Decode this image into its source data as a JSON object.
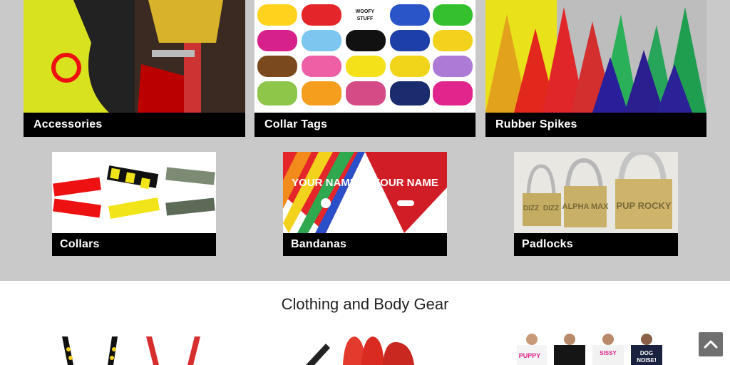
{
  "categories_row1": [
    {
      "label": "Accessories"
    },
    {
      "label": "Collar Tags"
    },
    {
      "label": "Rubber Spikes"
    }
  ],
  "categories_row2": [
    {
      "label": "Collars"
    },
    {
      "label": "Bandanas"
    },
    {
      "label": "Padlocks"
    }
  ],
  "bandanas_image_text": {
    "left": "YOUR NAME",
    "right": "YOUR NAME"
  },
  "padlocks_image_text": [
    "DIZZ",
    "DIZZ",
    "ALPHA MAX",
    "PUP ROCKY"
  ],
  "collar_tags_image_text": [
    "WOOFY",
    "STUFF"
  ],
  "section": {
    "title": "Clothing and Body Gear"
  },
  "bottom_row_image_text": [
    "PUPPY",
    "SISSY",
    "DOG",
    "NOISE!"
  ],
  "back_to_top": {
    "icon": "chevron-up-icon"
  }
}
